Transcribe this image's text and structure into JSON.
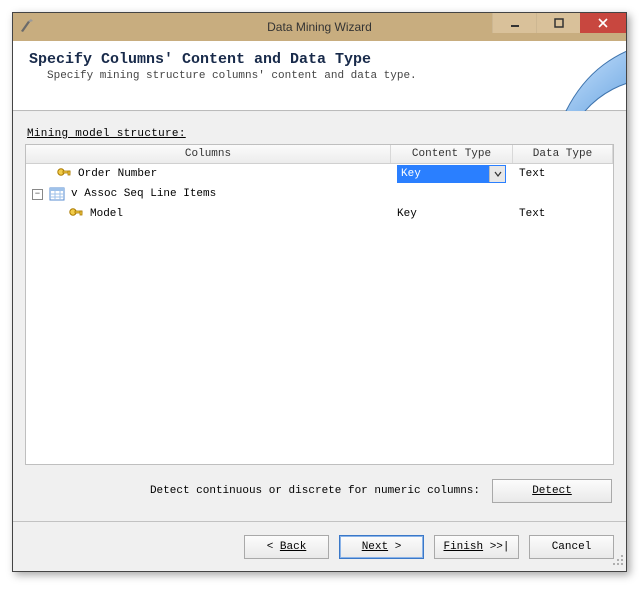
{
  "window": {
    "title": "Data Mining Wizard"
  },
  "header": {
    "heading": "Specify Columns' Content and Data Type",
    "subheading": "Specify mining structure columns' content and data type."
  },
  "section_label": "Mining model structure:",
  "columns_header": {
    "c1": "Columns",
    "c2": "Content Type",
    "c3": "Data Type"
  },
  "rows": {
    "r0": {
      "name": "Order Number",
      "content_type": "Key",
      "data_type": "Text"
    },
    "r1": {
      "name": "v Assoc Seq Line Items"
    },
    "r2": {
      "name": "Model",
      "content_type": "Key",
      "data_type": "Text"
    }
  },
  "detect": {
    "hint": "Detect continuous or discrete for numeric columns:",
    "button": "Detect"
  },
  "footer": {
    "back": "Back",
    "next": "Next",
    "finish": "Finish",
    "cancel": "Cancel"
  }
}
